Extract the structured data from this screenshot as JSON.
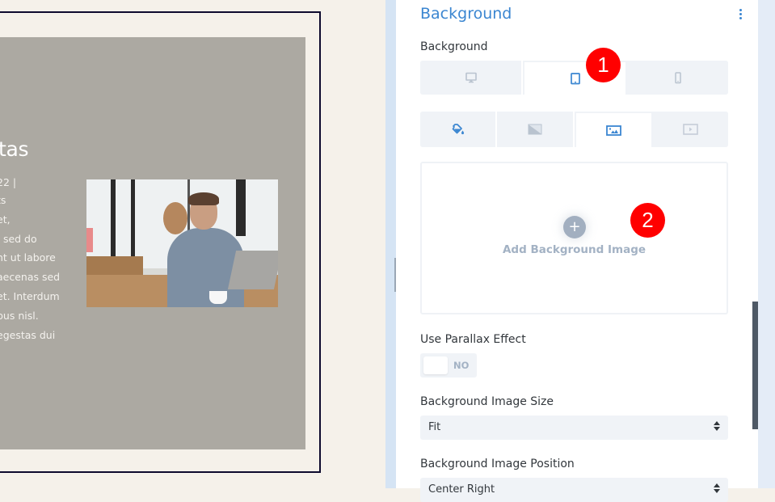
{
  "preview": {
    "post_title_fragment": "tas",
    "post_meta_fragment": "22 |",
    "post_body_lines": [
      "ts",
      "et,",
      ", sed do",
      "nt ut labore",
      "aecenas sed",
      "et. Interdum",
      "bus nisl.",
      "egestas dui"
    ],
    "photo_alt": "man working on laptop in cafe"
  },
  "panel": {
    "title": "Background",
    "background_label": "Background",
    "device_tabs": [
      {
        "name": "desktop",
        "icon": "desktop-icon",
        "active": false
      },
      {
        "name": "tablet",
        "icon": "tablet-icon",
        "active": true
      },
      {
        "name": "phone",
        "icon": "phone-icon",
        "active": false
      }
    ],
    "bg_type_tabs": [
      {
        "name": "color",
        "icon": "paint-bucket-icon",
        "active": false
      },
      {
        "name": "gradient",
        "icon": "gradient-icon",
        "active": false
      },
      {
        "name": "image",
        "icon": "image-icon",
        "active": true
      },
      {
        "name": "video",
        "icon": "video-icon",
        "active": false
      }
    ],
    "upload": {
      "plus": "+",
      "label": "Add Background Image"
    },
    "parallax": {
      "label": "Use Parallax Effect",
      "value": "NO"
    },
    "image_size": {
      "label": "Background Image Size",
      "value": "Fit"
    },
    "image_position": {
      "label": "Background Image Position",
      "value": "Center Right"
    }
  },
  "annotations": [
    {
      "number": "1",
      "color": "#ff0000"
    },
    {
      "number": "2",
      "color": "#ff0000"
    }
  ],
  "colors": {
    "accent": "#3b86d1",
    "card_bg": "#aca9a2",
    "page_bg": "#f5f1ea",
    "control_bg": "#f0f3f7"
  }
}
